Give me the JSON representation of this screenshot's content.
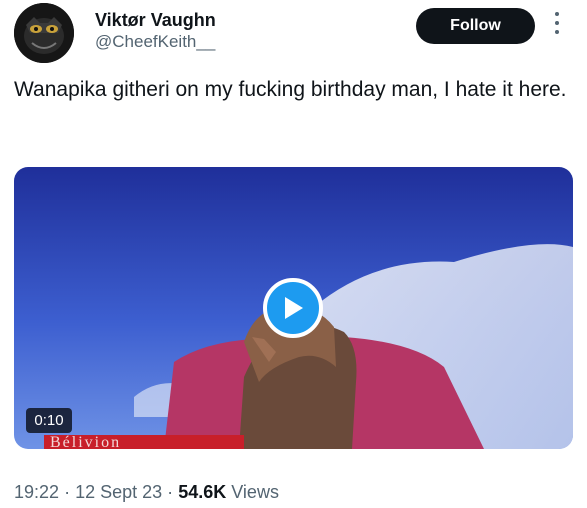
{
  "author": {
    "name": "Viktør Vaughn",
    "handle": "@CheefKeith__"
  },
  "actions": {
    "follow_label": "Follow"
  },
  "tweet": {
    "text": "Wanapika githeri on my fucking birthday man, I hate it here."
  },
  "media": {
    "type": "video",
    "duration": "0:10",
    "overlay_text": "Bélivion"
  },
  "meta": {
    "time": "19:22",
    "separator": "·",
    "date": "12 Sept 23",
    "views_count": "54.6K",
    "views_label": "Views"
  },
  "colors": {
    "accent": "#1d9bf0",
    "button_bg": "#0f1419",
    "secondary_text": "#536471"
  },
  "icons": {
    "more": "more-vertical-icon",
    "play": "play-icon"
  }
}
